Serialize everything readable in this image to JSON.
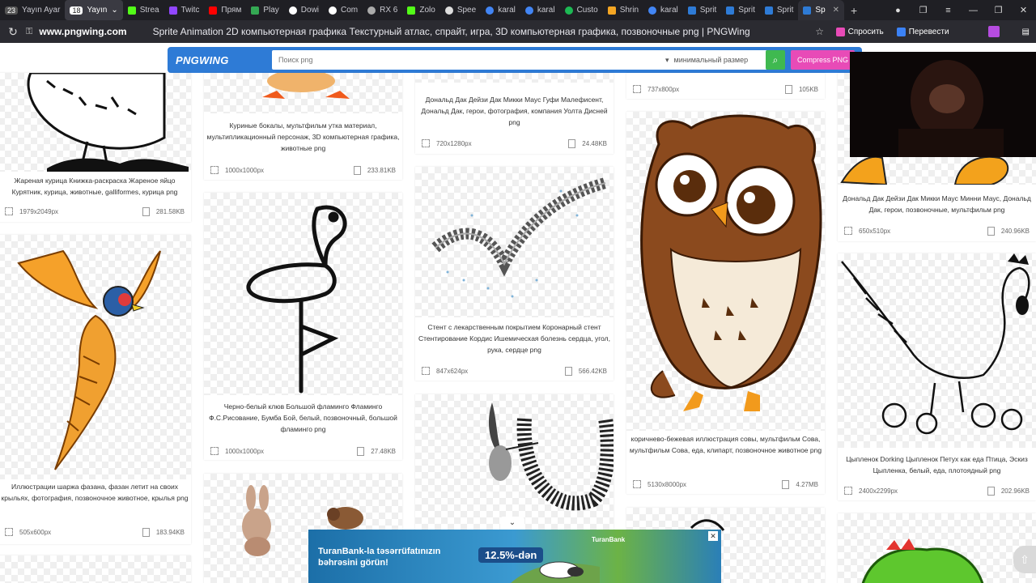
{
  "browser": {
    "tabs": [
      {
        "label": "Yayın Ayar",
        "color": "#888888",
        "prefix": "23"
      },
      {
        "label": "Yayın",
        "color": "#777777",
        "prefix": "18"
      },
      {
        "label": "Strea",
        "color": "#53fc18"
      },
      {
        "label": "Twitc",
        "color": "#9146ff"
      },
      {
        "label": "Прям",
        "color": "#ff0000"
      },
      {
        "label": "Play",
        "color": "#34a853"
      },
      {
        "label": "Dowi",
        "color": "#ffffff"
      },
      {
        "label": "Com",
        "color": "#ffffff"
      },
      {
        "label": "RX 6",
        "color": "#aaaaaa"
      },
      {
        "label": "Zolo",
        "color": "#53fc18"
      },
      {
        "label": "Spee",
        "color": "#dddddd"
      },
      {
        "label": "karal",
        "color": "#4285f4"
      },
      {
        "label": "karal",
        "color": "#4285f4"
      },
      {
        "label": "Custo",
        "color": "#1db954"
      },
      {
        "label": "Shrin",
        "color": "#f5a623"
      },
      {
        "label": "karal",
        "color": "#4285f4"
      },
      {
        "label": "Sprit",
        "color": "#2e7bd6"
      },
      {
        "label": "Sprit",
        "color": "#2e7bd6"
      },
      {
        "label": "Sprit",
        "color": "#2e7bd6"
      },
      {
        "label": "Sp",
        "color": "#2e7bd6",
        "active": true
      }
    ],
    "new_tab": "+",
    "window_controls": [
      "—",
      "❐",
      "≡",
      "—",
      "❐",
      "✕"
    ],
    "address": {
      "reload": "↻",
      "lock": "🔒",
      "domain": "www.pngwing.com",
      "title": "Sprite Animation 2D компьютерная графика Текстурный атлас, спрайт, игра, 3D компьютерная графика, позвоночные png | PNGWing",
      "bookmark": "☆",
      "ask": "Спросить",
      "translate": "Перевести"
    }
  },
  "site": {
    "logo": "PNGWING",
    "search_placeholder": "Поиск png",
    "size_select": "минимальный размер",
    "search_button": "⌕",
    "compress_button": "Compress PNG"
  },
  "cards": [
    {
      "desc": "Жареная курица Книжка-раскраска Жареное яйцо Курятник, курица, животные, galliformes, курица png",
      "dim": "1979x2049px",
      "size": "281.58KB"
    },
    {
      "desc": "Иллюстрации шаржа фазана, фазан летит на своих крыльях, фотография, позвоночное животное, крылья png",
      "dim": "505x600px",
      "size": "183.94KB"
    },
    {
      "desc": "Куриные бокалы, мультфильм утка материал, мультипликационный персонаж, 3D компьютерная графика, животные png",
      "dim": "1000x1000px",
      "size": "233.81KB"
    },
    {
      "desc": "Черно-белый клюв Большой фламинго Фламинго Ф.С.Рисование, Бумба Бой, белый, позвоночный, большой фламинго png",
      "dim": "1000x1000px",
      "size": "27.48KB"
    },
    {
      "desc": "Дональд Дак Дейзи Дак Микки Маус Гуфи Малефисент, Дональд Дак, герои, фотография, компания Уолта Дисней png",
      "dim": "720x1280px",
      "size": "24.48KB"
    },
    {
      "desc": "Стент с лекарственным покрытием Коронарный стент Стентирование Кордис Ишемическая болезнь сердца, угол, рука, сердце png",
      "dim": "847x624px",
      "size": "566.42KB"
    },
    {
      "desc": "",
      "dim": "737x800px",
      "size": "105KB"
    },
    {
      "desc": "коричнево-бежевая иллюстрация совы, мультфильм Сова, мультфильм Сова, еда, клипарт, позвоночное животное png",
      "dim": "5130x8000px",
      "size": "4.27MB"
    },
    {
      "desc": "Дональд Дак Дейзи Дак Микки Маус Минни Маус, Дональд Дак, герои, позвоночные, мультфильм png",
      "dim": "650x510px",
      "size": "240.96KB"
    },
    {
      "desc": "Цыпленок Dorking Цыпленок Петух как еда Птица, Эскиз Цыпленка, белый, еда, плотоядный png",
      "dim": "2400x2299px",
      "size": "202.96KB"
    }
  ],
  "ad": {
    "headline": "TuranBank-la təsərrüfatınızın bəhrəsini görün!",
    "rate": "12.5%-dən",
    "brand": "TuranBank",
    "toggle": "⌄",
    "close": "✕"
  },
  "scroll_top": "⇧"
}
